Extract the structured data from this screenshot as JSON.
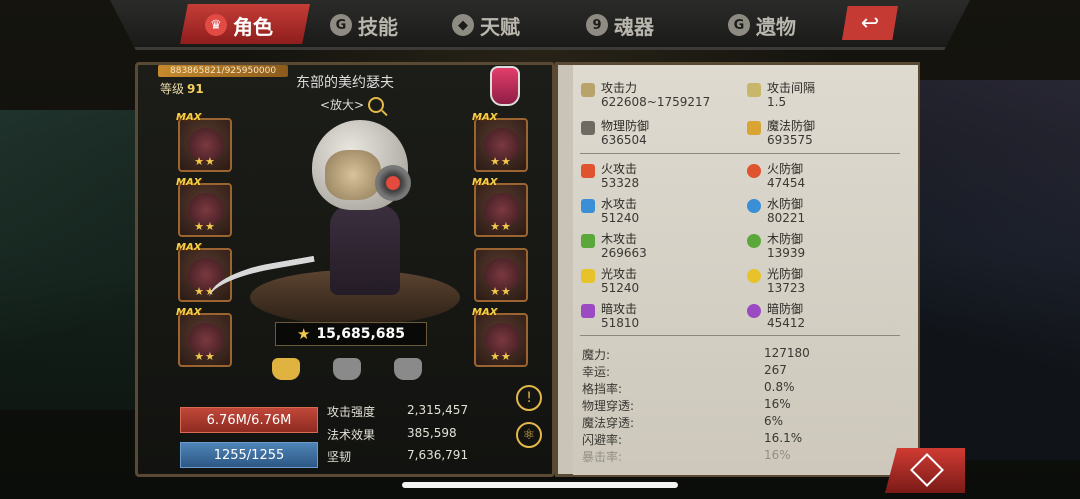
{
  "tabs": [
    {
      "label": "角色",
      "active": true,
      "icon": "crown-icon"
    },
    {
      "label": "技能",
      "icon": "skill-icon"
    },
    {
      "label": "天赋",
      "icon": "talent-icon"
    },
    {
      "label": "魂器",
      "icon": "soul-icon"
    },
    {
      "label": "遗物",
      "icon": "relic-icon"
    }
  ],
  "back_icon": "return-arrow-icon",
  "hero": {
    "exp": "883865821/925950000",
    "level_label": "等级",
    "level": "91",
    "name": "东部的美约瑟夫",
    "zoom_label": "<放大>",
    "power": "15,685,685",
    "hp": "6.76M/6.76M",
    "mp": "1255/1255"
  },
  "bottom_stats": [
    {
      "label": "攻击强度",
      "value": "2,315,457"
    },
    {
      "label": "法术效果",
      "value": "385,598"
    },
    {
      "label": "坚韧",
      "value": "7,636,791"
    }
  ],
  "equip_badge": "MAX",
  "stars": "★★",
  "stats": {
    "atk_label": "攻击力",
    "atk": "622608~1759217",
    "interval_label": "攻击间隔",
    "interval": "1.5",
    "pdef_label": "物理防御",
    "pdef": "636504",
    "mdef_label": "魔法防御",
    "mdef": "693575",
    "elements": [
      {
        "atk_label": "火攻击",
        "atk": "53328",
        "def_label": "火防御",
        "def": "47454",
        "color": "#e0532f"
      },
      {
        "atk_label": "水攻击",
        "atk": "51240",
        "def_label": "水防御",
        "def": "80221",
        "color": "#3a8fd6"
      },
      {
        "atk_label": "木攻击",
        "atk": "269663",
        "def_label": "木防御",
        "def": "13939",
        "color": "#5aa83a"
      },
      {
        "atk_label": "光攻击",
        "atk": "51240",
        "def_label": "光防御",
        "def": "13723",
        "color": "#e8c22a"
      },
      {
        "atk_label": "暗攻击",
        "atk": "51810",
        "def_label": "暗防御",
        "def": "45412",
        "color": "#9b4ac2"
      }
    ],
    "secondary": [
      {
        "label": "魔力:",
        "value": "127180"
      },
      {
        "label": "幸运:",
        "value": "267"
      },
      {
        "label": "格挡率:",
        "value": "0.8%"
      },
      {
        "label": "物理穿透:",
        "value": "16%"
      },
      {
        "label": "魔法穿透:",
        "value": "6%"
      },
      {
        "label": "闪避率:",
        "value": "16.1%"
      },
      {
        "label": "暴击率:",
        "value": "16%"
      }
    ]
  }
}
